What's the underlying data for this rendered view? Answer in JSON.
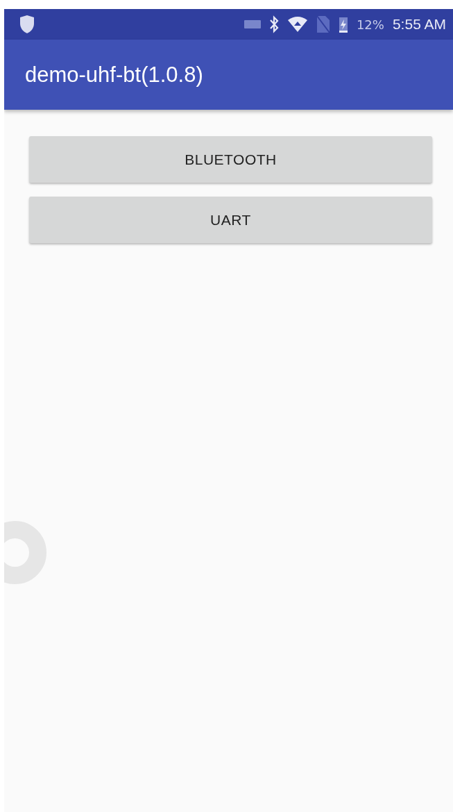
{
  "status_bar": {
    "battery": "12%",
    "time": "5:55 AM"
  },
  "app_bar": {
    "title": "demo-uhf-bt(1.0.8)"
  },
  "buttons": [
    {
      "label": "BLUETOOTH"
    },
    {
      "label": "UART"
    }
  ]
}
